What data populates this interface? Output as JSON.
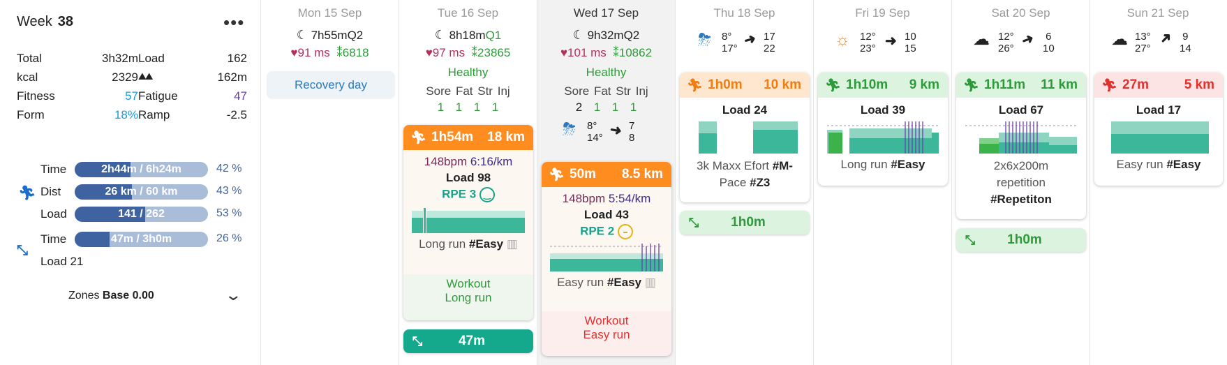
{
  "summary": {
    "week_label": "Week",
    "week_num": "38",
    "more_label": "•••",
    "stats": [
      {
        "k1": "Total",
        "v1": "3h32m",
        "k2": "Load",
        "v2": "162"
      },
      {
        "k1": "kcal",
        "v1": "2329",
        "k2": "",
        "v2": "162m"
      },
      {
        "k1": "Fitness",
        "v1": "57",
        "k2": "Fatigue",
        "v2": "47"
      },
      {
        "k1": "Form",
        "v1": "18%",
        "k2": "Ramp",
        "v2": "-2.5"
      }
    ],
    "progress": [
      {
        "label": "Time",
        "text": "2h44m / 6h24m",
        "pct": "42 %",
        "fill": 0.42
      },
      {
        "label": "Dist",
        "text": "26 km / 60 km",
        "pct": "43 %",
        "fill": 0.43
      },
      {
        "label": "Load",
        "text": "141 / 262",
        "pct": "53 %",
        "fill": 0.53
      },
      {
        "label": "Time",
        "text": "47m / 3h0m",
        "pct": "26 %",
        "fill": 0.26
      }
    ],
    "strength_load": "Load 21",
    "zones_label": "Zones",
    "zones_value": "Base 0.00"
  },
  "days": [
    {
      "head": "Mon 15 Sep",
      "sleep": "7h55m",
      "q": "Q2",
      "hr": "91 ms",
      "steps": "6818",
      "recovery": "Recovery day"
    },
    {
      "head": "Tue 16 Sep",
      "sleep": "8h18m",
      "q": "Q1",
      "hr": "97 ms",
      "steps": "23865",
      "status": "Healthy",
      "well_h": [
        "Sore",
        "Fat",
        "Str",
        "Inj"
      ],
      "well_v": [
        "1",
        "1",
        "1",
        "1"
      ]
    },
    {
      "head": "Wed 17 Sep",
      "sleep": "9h32m",
      "q": "Q2",
      "hr": "101 ms",
      "steps": "10862",
      "status": "Healthy",
      "well_h": [
        "Sore",
        "Fat",
        "Str",
        "Inj"
      ],
      "well_v": [
        "2",
        "1",
        "1",
        "1"
      ],
      "weather": {
        "t1": "8°",
        "t2": "14°",
        "r1": "7",
        "r2": "8"
      }
    },
    {
      "head": "Thu 18 Sep",
      "weather": {
        "t1": "8°",
        "t2": "17°",
        "r1": "17",
        "r2": "22"
      }
    },
    {
      "head": "Fri 19 Sep",
      "weather": {
        "t1": "12°",
        "t2": "23°",
        "r1": "10",
        "r2": "15"
      }
    },
    {
      "head": "Sat 20 Sep",
      "weather": {
        "t1": "12°",
        "t2": "26°",
        "r1": "6",
        "r2": "10"
      }
    },
    {
      "head": "Sun 21 Sep",
      "weather": {
        "t1": "13°",
        "t2": "27°",
        "r1": "9",
        "r2": "14"
      }
    }
  ],
  "cards": {
    "tue": {
      "dur": "1h54m",
      "dist": "18 km",
      "hr": "148bpm",
      "pace": "6:16/km",
      "load": "Load 98",
      "rpe": "RPE 3",
      "tag": "Long run",
      "tagb": "#Easy",
      "foot1": "Workout",
      "foot2": "Long run",
      "strength": "47m"
    },
    "wed": {
      "dur": "50m",
      "dist": "8.5 km",
      "hr": "148bpm",
      "pace": "5:54/km",
      "load": "Load 43",
      "rpe": "RPE 2",
      "tag": "Easy run",
      "tagb": "#Easy",
      "foot1": "Workout",
      "foot2": "Easy run"
    },
    "thu": {
      "dur": "1h0m",
      "dist": "10 km",
      "load": "Load 24",
      "tag1": "3k Maxx Efort",
      "tagb1": "#M-",
      "tag2": "Pace",
      "tagb2": "#Z3",
      "strength": "1h0m"
    },
    "fri": {
      "dur": "1h10m",
      "dist": "9 km",
      "load": "Load 39",
      "tag": "Long run",
      "tagb": "#Easy"
    },
    "sat": {
      "dur": "1h11m",
      "dist": "11 km",
      "load": "Load 67",
      "tag1": "2x6x200m",
      "tag2": "repetition",
      "tagb": "#Repetiton",
      "strength": "1h0m"
    },
    "sun": {
      "dur": "27m",
      "dist": "5 km",
      "load": "Load 17",
      "tag": "Easy run",
      "tagb": "#Easy"
    }
  },
  "colors": {
    "orange": "#ff8c1f",
    "green": "#2e9a3a",
    "teal": "#14a88c",
    "blue": "#3e63a0",
    "red": "#e0312f"
  }
}
